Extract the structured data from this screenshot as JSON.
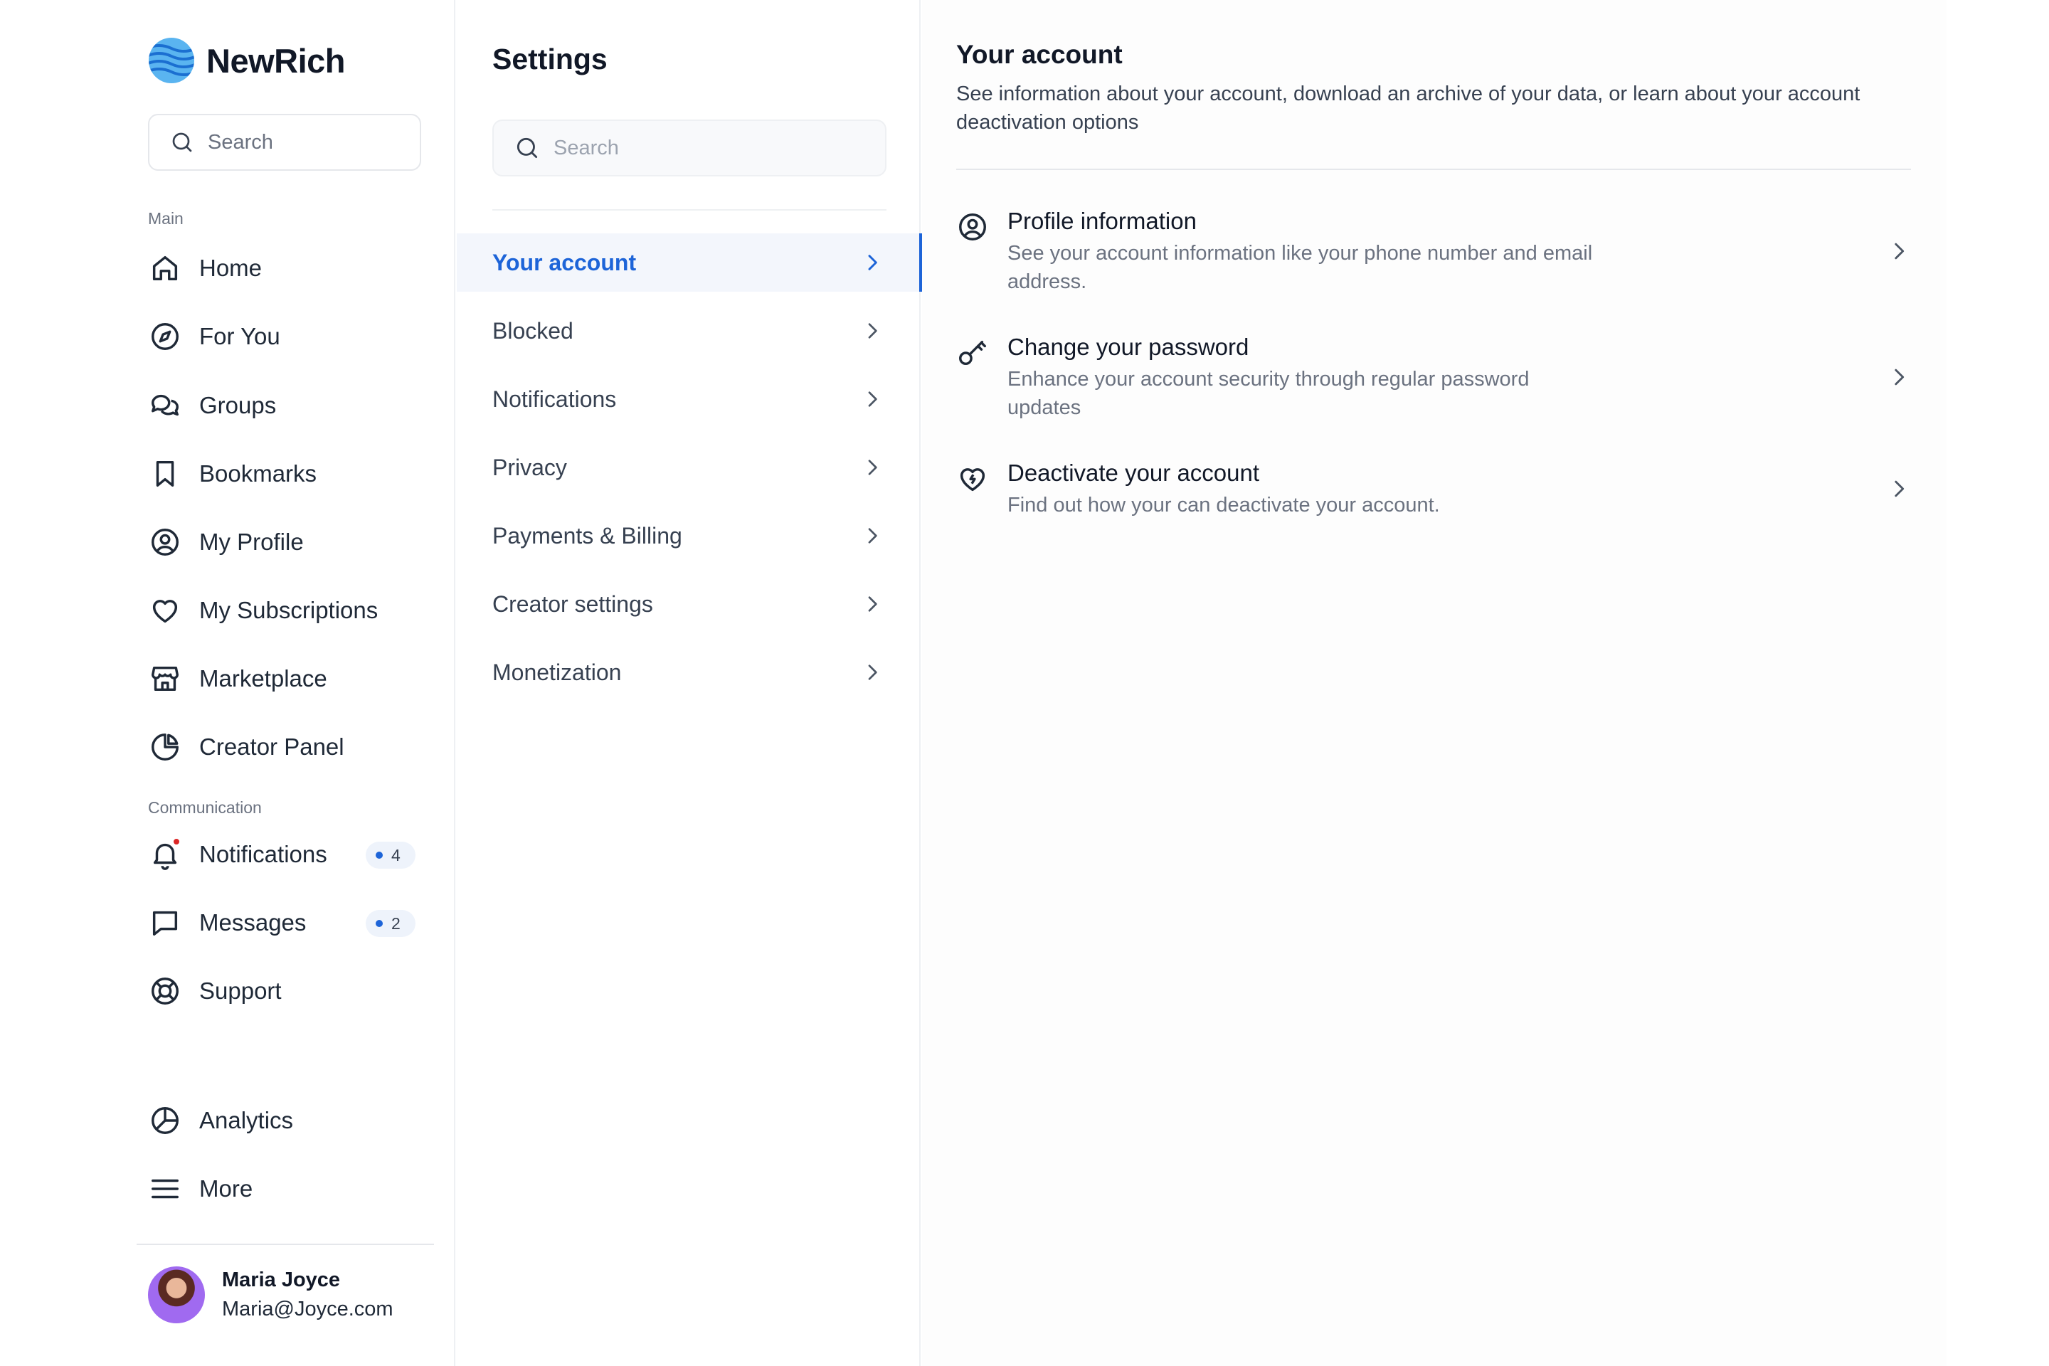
{
  "brand": {
    "name": "NewRich",
    "accent": "#1d64d8"
  },
  "sidebar": {
    "search_placeholder": "Search",
    "main_label": "Main",
    "communication_label": "Communication",
    "items": [
      {
        "label": "Home",
        "icon": "home-icon"
      },
      {
        "label": "For You",
        "icon": "compass-icon"
      },
      {
        "label": "Groups",
        "icon": "chat-bubbles-icon"
      },
      {
        "label": "Bookmarks",
        "icon": "bookmark-icon"
      },
      {
        "label": "My Profile",
        "icon": "user-circle-icon"
      },
      {
        "label": "My Subscriptions",
        "icon": "heart-icon"
      },
      {
        "label": "Marketplace",
        "icon": "store-icon"
      },
      {
        "label": "Creator Panel",
        "icon": "pie-chart-icon"
      }
    ],
    "comm_items": [
      {
        "label": "Notifications",
        "icon": "bell-icon",
        "badge": "4"
      },
      {
        "label": "Messages",
        "icon": "message-icon",
        "badge": "2"
      },
      {
        "label": "Support",
        "icon": "lifebuoy-icon"
      }
    ],
    "bottom_items": [
      {
        "label": "Analytics",
        "icon": "analytics-icon"
      },
      {
        "label": "More",
        "icon": "menu-icon"
      }
    ],
    "user": {
      "name": "Maria Joyce",
      "email": "Maria@Joyce.com"
    }
  },
  "settings": {
    "title": "Settings",
    "search_placeholder": "Search",
    "items": [
      {
        "label": "Your account",
        "active": true
      },
      {
        "label": "Blocked"
      },
      {
        "label": "Notifications"
      },
      {
        "label": "Privacy"
      },
      {
        "label": "Payments & Billing"
      },
      {
        "label": "Creator settings"
      },
      {
        "label": "Monetization"
      }
    ]
  },
  "content": {
    "title": "Your account",
    "description": "See information about your account, download an archive of your data, or learn about your account deactivation options",
    "rows": [
      {
        "title": "Profile information",
        "desc": "See your account information like your phone number and email address.",
        "icon": "user-circle-icon"
      },
      {
        "title": "Change your password",
        "desc": "Enhance your account security through regular password updates",
        "icon": "key-icon"
      },
      {
        "title": "Deactivate your account",
        "desc": "Find out how your can deactivate your account.",
        "icon": "broken-heart-icon"
      }
    ]
  }
}
